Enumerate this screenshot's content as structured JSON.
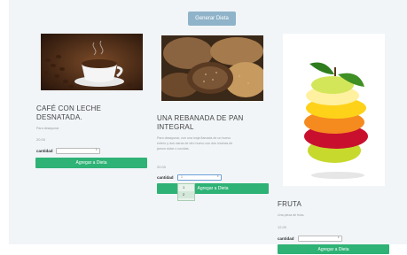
{
  "header": {
    "generate_label": "Generar Dieta"
  },
  "cards": [
    {
      "title_line1": "CAFÉ CON LECHE",
      "title_line2": "DESNATADA.",
      "description": "Para desayunar.",
      "price": "20.00",
      "qty_label": "cantidad",
      "qty_value": "1",
      "add_label": "Agregar a Dieta",
      "image": "coffee-cup-image"
    },
    {
      "title_line1": "UNA REBANADA DE PAN",
      "title_line2": "INTEGRAL",
      "desc_line1": "Para desayunar, con una lonja flamada de un huevo",
      "desc_line2": "entero y dos claras de otro huevo con dos lonchas de",
      "desc_line3": "jamon dulce u cocidas.",
      "price": "20.00",
      "qty_label": "cantidad",
      "qty_value": "1",
      "add_label": "Agregar a Dieta",
      "image": "bread-image"
    },
    {
      "title_line1": "FRUTA",
      "description": "Una pieza de fruta.",
      "price": "12.00",
      "qty_label": "cantidad",
      "qty_value": "1",
      "add_label": "Agregar a Dieta",
      "image": "stacked-fruit-image"
    }
  ],
  "dropdown": {
    "options": [
      "1",
      "2"
    ],
    "selected": "2"
  },
  "colors": {
    "accent_green": "#2eb275",
    "generate_button": "#8fb3c9",
    "background": "#f1f5f8"
  }
}
